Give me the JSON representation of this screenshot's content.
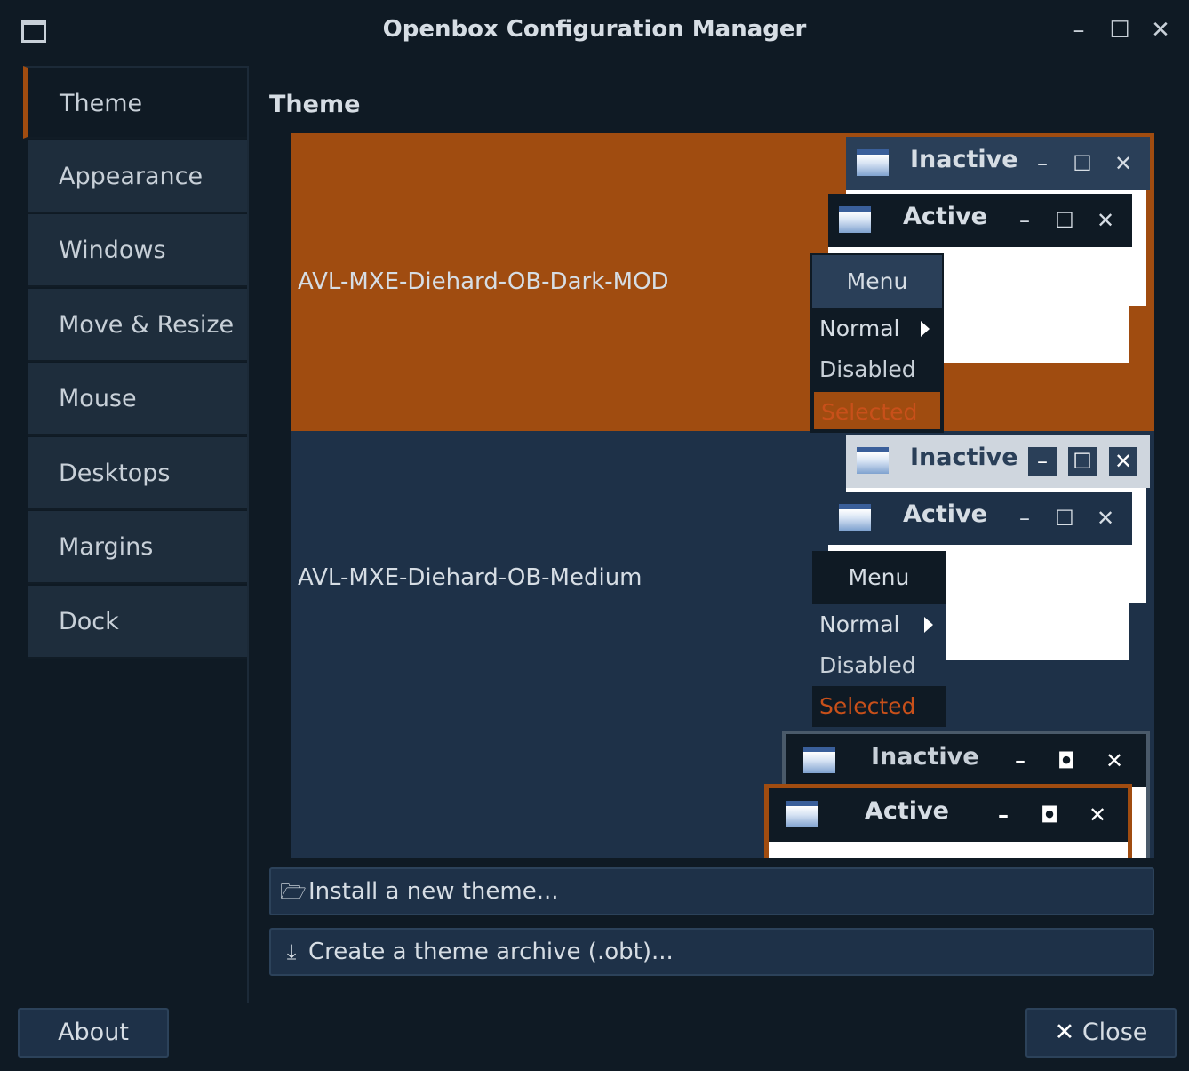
{
  "window": {
    "title": "Openbox Configuration Manager",
    "controls": {
      "minimize": "–",
      "maximize": "☐",
      "close": "✕"
    }
  },
  "sidebar": {
    "items": [
      {
        "label": "Theme",
        "active": true
      },
      {
        "label": "Appearance"
      },
      {
        "label": "Windows"
      },
      {
        "label": "Move & Resize"
      },
      {
        "label": "Mouse"
      },
      {
        "label": "Desktops"
      },
      {
        "label": "Margins"
      },
      {
        "label": "Dock"
      }
    ]
  },
  "main": {
    "section_title": "Theme",
    "themes": [
      {
        "name": "AVL-MXE-Diehard-OB-Dark-MOD",
        "selected": true,
        "preview": {
          "inactive_label": "Inactive",
          "active_label": "Active",
          "menu": {
            "title": "Menu",
            "normal": "Normal",
            "disabled": "Disabled",
            "selected": "Selected"
          }
        }
      },
      {
        "name": "AVL-MXE-Diehard-OB-Medium",
        "selected": false,
        "preview": {
          "inactive_label": "Inactive",
          "active_label": "Active",
          "menu": {
            "title": "Menu",
            "normal": "Normal",
            "disabled": "Disabled",
            "selected": "Selected"
          }
        }
      },
      {
        "name": "",
        "selected": false,
        "preview": {
          "inactive_label": "Inactive",
          "active_label": "Active"
        }
      }
    ],
    "install_button": {
      "label": "Install a new theme...",
      "icon": "folder-icon"
    },
    "archive_button": {
      "label": "Create a theme archive (.obt)...",
      "icon": "download-icon"
    }
  },
  "footer": {
    "about_label": "About",
    "close_label": "Close",
    "close_icon": "✕"
  },
  "colors": {
    "background": "#0f1a24",
    "panel": "#1e2d3c",
    "list_background": "#1e3148",
    "selection": "#a04c10",
    "accent_text": "#c8501a"
  }
}
